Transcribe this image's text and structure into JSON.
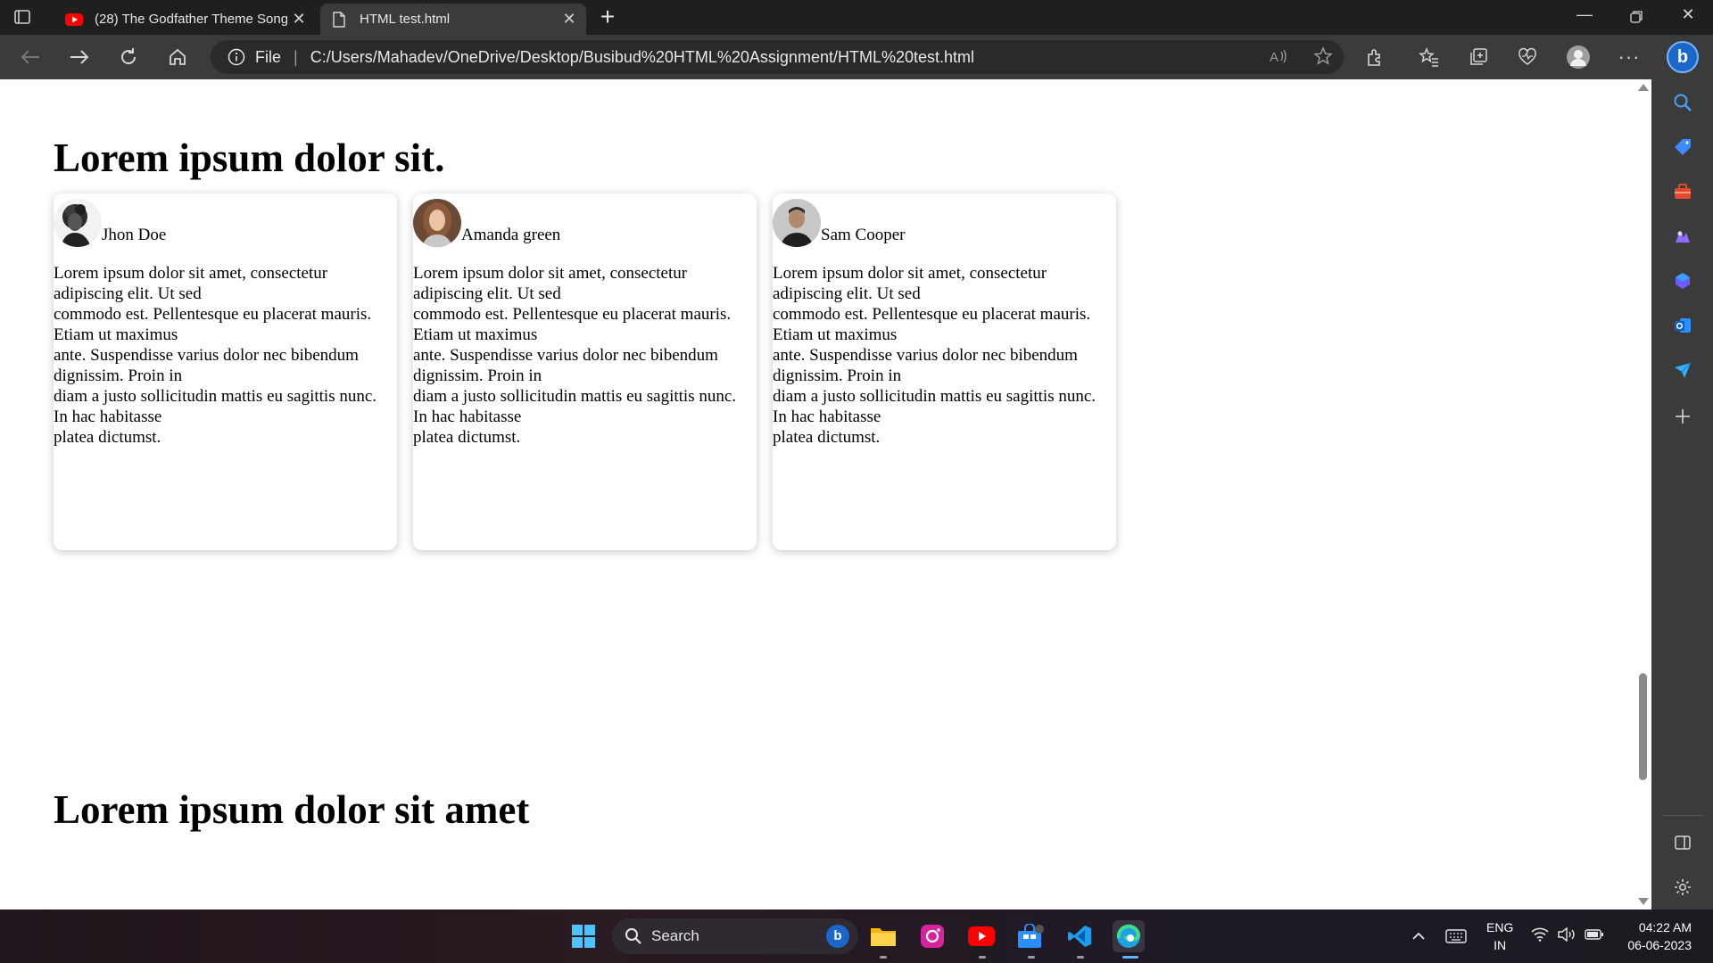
{
  "browser": {
    "tabs": [
      {
        "title": "(28) The Godfather Theme Song",
        "icon": "youtube-icon",
        "active": false
      },
      {
        "title": "HTML test.html",
        "icon": "file-icon",
        "active": true
      }
    ],
    "address": {
      "scheme_label": "File",
      "url": "C:/Users/Mahadev/OneDrive/Desktop/Busibud%20HTML%20Assignment/HTML%20test.html"
    }
  },
  "page": {
    "heading_1": "Lorem ipsum dolor sit.",
    "heading_2": "Lorem ipsum dolor sit amet",
    "cards": [
      {
        "name": "Jhon Doe",
        "body_lines": [
          "Lorem ipsum dolor sit amet, consectetur",
          "adipiscing elit. Ut sed",
          "commodo est. Pellentesque eu placerat mauris.",
          "Etiam ut maximus",
          "ante. Suspendisse varius dolor nec bibendum",
          "dignissim. Proin in",
          "diam a justo sollicitudin mattis eu sagittis nunc.",
          "In hac habitasse",
          "platea dictumst."
        ]
      },
      {
        "name": "Amanda green",
        "body_lines": [
          "Lorem ipsum dolor sit amet, consectetur",
          "adipiscing elit. Ut sed",
          "commodo est. Pellentesque eu placerat mauris.",
          "Etiam ut maximus",
          "ante. Suspendisse varius dolor nec bibendum",
          "dignissim. Proin in",
          "diam a justo sollicitudin mattis eu sagittis nunc.",
          "In hac habitasse",
          "platea dictumst."
        ]
      },
      {
        "name": "Sam Cooper",
        "body_lines": [
          "Lorem ipsum dolor sit amet, consectetur",
          "adipiscing elit. Ut sed",
          "commodo est. Pellentesque eu placerat mauris.",
          "Etiam ut maximus",
          "ante. Suspendisse varius dolor nec bibendum",
          "dignissim. Proin in",
          "diam a justo sollicitudin mattis eu sagittis nunc.",
          "In hac habitasse",
          "platea dictumst."
        ]
      }
    ]
  },
  "taskbar": {
    "search_label": "Search",
    "language": {
      "line1": "ENG",
      "line2": "IN"
    },
    "time": "04:22 AM",
    "date": "06-06-2023"
  },
  "colors": {
    "tab_bar": "#1f1f1f",
    "toolbar": "#3b3b3b",
    "youtube_red": "#ff0000",
    "edge_blue": "#1b66c9"
  }
}
